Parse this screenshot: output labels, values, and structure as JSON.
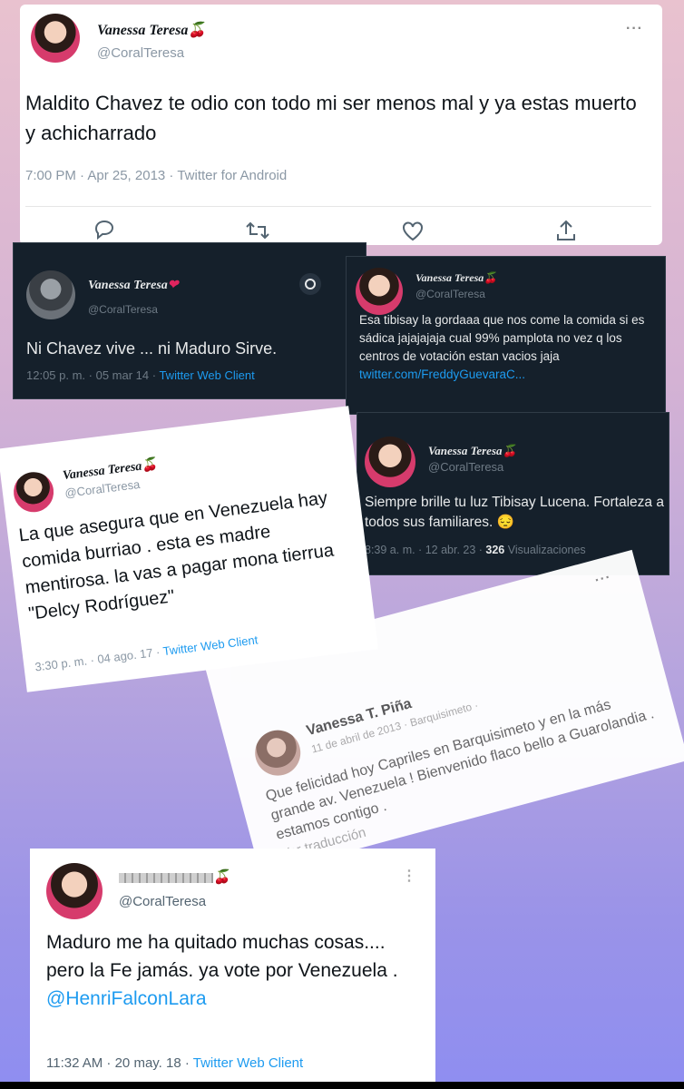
{
  "tweets": {
    "t1": {
      "name": "Vanessa Teresa",
      "name_emoji": "🍒",
      "handle": "@CoralTeresa",
      "text": "Maldito Chavez te odio con todo mi ser menos mal y ya estas muerto y achicharrado",
      "time": "7:00 PM · Apr 25, 2013 · Twitter for Android",
      "more": "···",
      "icons": [
        "reply-icon",
        "retweet-icon",
        "like-icon",
        "share-icon"
      ]
    },
    "t2": {
      "name": "Vanessa Teresa",
      "name_emoji": "❤",
      "handle": "@CoralTeresa",
      "text": "Ni Chavez vive ... ni Maduro Sirve.",
      "time": "12:05 p. m. · 05 mar 14 · ",
      "client": "Twitter Web Client"
    },
    "t3": {
      "name": "Vanessa Teresa",
      "name_emoji": "🍒",
      "handle": "@CoralTeresa",
      "text": "Esa tibisay la gordaaa que nos come la comida si es sádica  jajajajaja cual 99% pamplota no vez q los centros de votación estan vacios jaja ",
      "link": "twitter.com/FreddyGuevaraC..."
    },
    "t4": {
      "name": "Vanessa Teresa",
      "name_emoji": "🍒",
      "handle": "@CoralTeresa",
      "text": "Siempre brille tu luz Tibisay Lucena. Fortaleza a todos sus familiares. 😔",
      "time": "8:39 a. m. · 12 abr. 23 · ",
      "views_count": "326",
      "views_label": " Visualizaciones"
    },
    "t5": {
      "name": "Vanessa Teresa",
      "name_emoji": "🍒",
      "handle": "@CoralTeresa",
      "text": "La que asegura que en Venezuela hay comida burriao . esta es madre mentirosa. la vas a pagar mona tierrua  \"Delcy Rodríguez\"",
      "time": "3:30 p. m. · 04 ago. 17 · ",
      "client": "Twitter Web Client"
    },
    "t6": {
      "name": "Vanessa T. Piña",
      "date": "11 de abril de 2013 · Barquisimeto ·",
      "text": "Que felicidad hoy Capriles en Barquisimeto y en la más grande av. Venezuela ! Bienvenido flaco bello a Guarolandia . estamos contigo .",
      "translate": "Ver traducción",
      "more": "···"
    },
    "t7": {
      "name_emoji": "🍒",
      "handle": "@CoralTeresa",
      "text": "Maduro me ha quitado muchas cosas.... pero la Fe jamás. ya vote por Venezuela .",
      "mention": "@HenriFalconLara",
      "time": "11:32 AM · 20 may. 18 · ",
      "client": "Twitter Web Client",
      "more": "⋮"
    }
  },
  "colors": {
    "dark_card": "#15202b",
    "link_blue": "#1d9bf0",
    "muted_gray": "#8b98a5"
  }
}
